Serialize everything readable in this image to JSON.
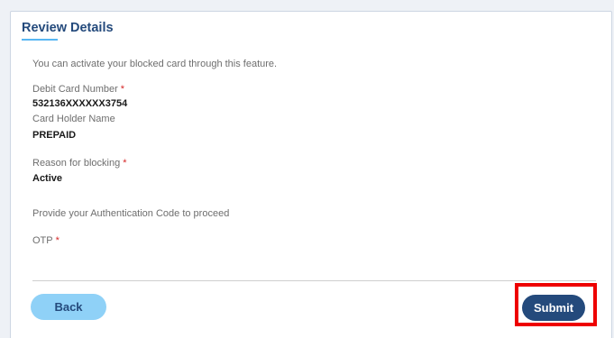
{
  "title": "Review Details",
  "intro": "You can activate your blocked card through this feature.",
  "required_mark": "*",
  "debit_card": {
    "label": "Debit Card Number",
    "value": "532136XXXXXX3754"
  },
  "card_holder": {
    "label": "Card Holder Name",
    "value": "PREPAID"
  },
  "reason": {
    "label": "Reason for blocking",
    "value": "Active"
  },
  "auth_text": "Provide your Authentication Code to proceed",
  "otp": {
    "label": "OTP",
    "value": ""
  },
  "buttons": {
    "back": "Back",
    "submit": "Submit"
  },
  "colors": {
    "brand_navy": "#244a7c",
    "accent_light_blue": "#8fd1f7",
    "highlight_red": "#ee0000",
    "required_red": "#d62828"
  }
}
